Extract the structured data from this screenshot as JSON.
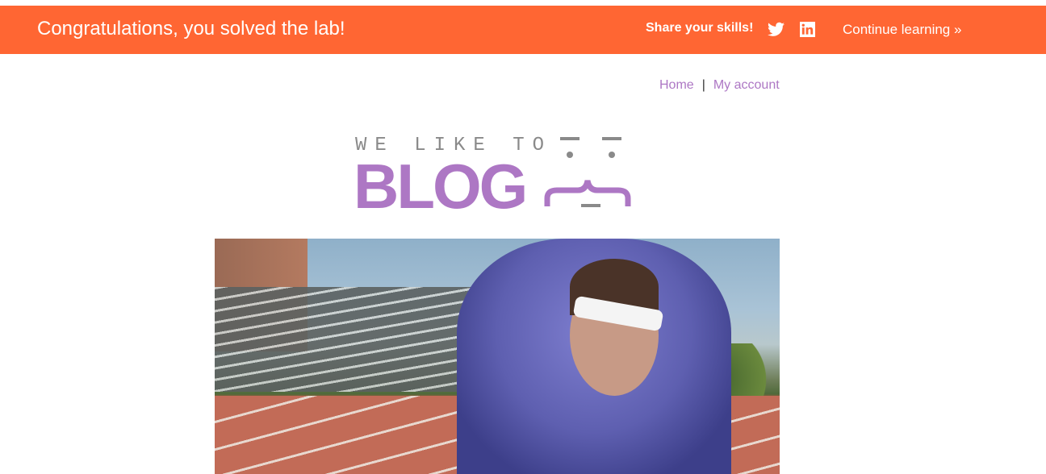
{
  "banner": {
    "title": "Congratulations, you solved the lab!",
    "share_label": "Share your skills!",
    "icons": [
      "twitter-icon",
      "linkedin-icon"
    ],
    "continue_label": "Continue learning »",
    "background_color": "#ff6633"
  },
  "nav": {
    "home": "Home",
    "separator": "|",
    "my_account": "My account",
    "link_color": "#ad77c4"
  },
  "logo": {
    "line1": "WE LIKE TO",
    "line2": "BLOG"
  }
}
